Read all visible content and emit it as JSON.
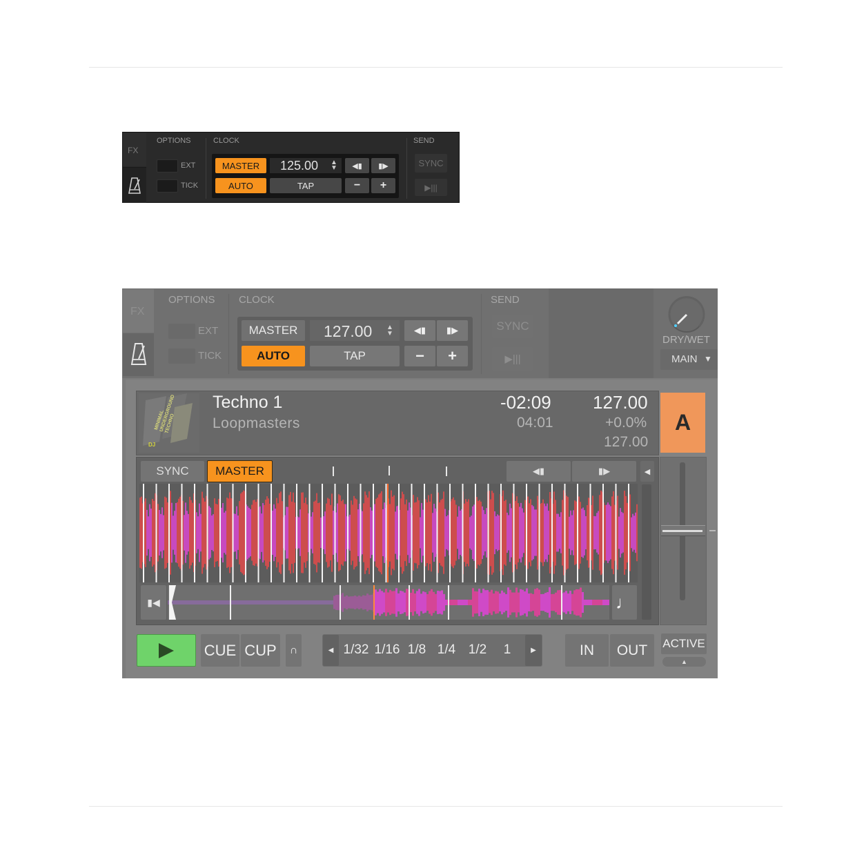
{
  "panel_small": {
    "fx_label": "FX",
    "options_header": "OPTIONS",
    "clock_header": "CLOCK",
    "send_header": "SEND",
    "ext_label": "EXT",
    "tick_label": "TICK",
    "master_label": "MASTER",
    "auto_label": "AUTO",
    "bpm": "125.00",
    "tap_label": "TAP",
    "minus": "−",
    "plus": "+",
    "nudge_back": "◀▮",
    "nudge_fwd": "▮▶",
    "sync_label": "SYNC",
    "play_pause": "▶|||",
    "metronome_icon": "metronome-icon"
  },
  "panel_large": {
    "fx_label": "FX",
    "options_header": "OPTIONS",
    "clock_header": "CLOCK",
    "send_header": "SEND",
    "ext_label": "EXT",
    "tick_label": "TICK",
    "master_label": "MASTER",
    "auto_label": "AUTO",
    "bpm": "127.00",
    "tap_label": "TAP",
    "minus": "−",
    "plus": "+",
    "nudge_back": "◀▮",
    "nudge_fwd": "▮▶",
    "sync_label": "SYNC",
    "play_pause": "▶|||",
    "dry_wet_label": "DRY/WET",
    "main_label": "MAIN",
    "deck": {
      "track_title": "Techno 1",
      "artist": "Loopmasters",
      "remaining_time": "-02:09",
      "total_time": "04:01",
      "bpm": "127.00",
      "pitch_percent": "+0.0%",
      "original_bpm": "127.00",
      "deck_letter": "A",
      "sync_label": "SYNC",
      "master_label": "MASTER",
      "nudge_back": "◀▮",
      "nudge_fwd": "▮▶",
      "play_icon": "play-icon",
      "cue_label": "CUE",
      "cup_label": "CUP",
      "loop_sizes": [
        "1/32",
        "1/16",
        "1/8",
        "1/4",
        "1/2",
        "1"
      ],
      "in_label": "IN",
      "out_label": "OUT",
      "active_label": "ACTIVE",
      "cover_art_text": "MINIMAL UNDERGROUND TECHNO",
      "cover_art_brand": "DJ"
    }
  },
  "colors": {
    "accent_orange": "#f7931e",
    "deck_letter_bg": "#f0975a",
    "play_green": "#6fd36a",
    "waveform_red": "#e04a4a",
    "waveform_magenta": "#d946d0"
  }
}
